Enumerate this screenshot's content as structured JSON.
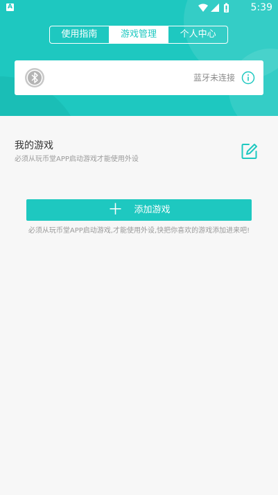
{
  "colors": {
    "accent": "#1ec8c0",
    "background": "#f7f7f7",
    "card": "#ffffff"
  },
  "status_bar": {
    "notification_badge": "A",
    "time": "5:39",
    "icons": [
      "wifi-icon",
      "signal-icon",
      "battery-icon"
    ]
  },
  "tabs": [
    {
      "label": "使用指南",
      "active": false
    },
    {
      "label": "游戏管理",
      "active": true
    },
    {
      "label": "个人中心",
      "active": false
    }
  ],
  "bluetooth": {
    "icon": "bluetooth-icon",
    "status_text": "蓝牙未连接",
    "info_icon": "info-icon"
  },
  "my_games": {
    "title": "我的游戏",
    "subtitle": "必须从玩币堂APP启动游戏才能使用外设",
    "edit_icon": "edit-icon"
  },
  "add_game": {
    "label": "添加游戏",
    "icon": "plus-icon",
    "hint": "必须从玩币堂APP启动游戏,才能使用外设,快把你喜欢的游戏添加进来吧!"
  }
}
